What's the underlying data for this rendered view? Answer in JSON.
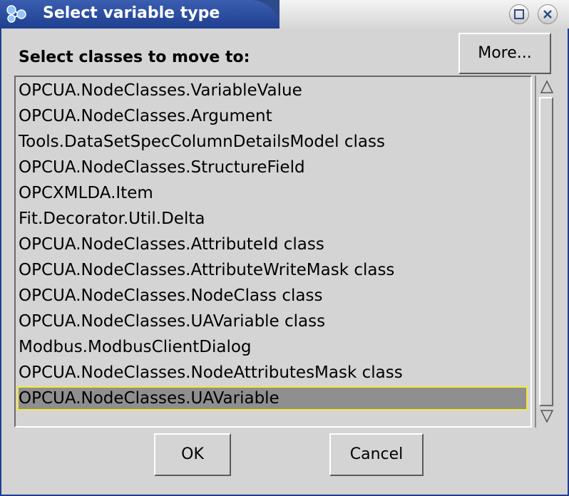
{
  "window": {
    "title": "Select variable type",
    "icons": {
      "app": "app-network-icon",
      "maximize": "maximize-icon",
      "close": "close-icon"
    }
  },
  "dialog": {
    "heading": "Select classes to move to:",
    "more_label": "More...",
    "ok_label": "OK",
    "cancel_label": "Cancel"
  },
  "list": {
    "items": [
      "OPCUA.NodeClasses.VariableValue",
      "OPCUA.NodeClasses.Argument",
      "Tools.DataSetSpecColumnDetailsModel class",
      "OPCUA.NodeClasses.StructureField",
      "OPCXMLDA.Item",
      "Fit.Decorator.Util.Delta",
      "OPCUA.NodeClasses.AttributeId class",
      "OPCUA.NodeClasses.AttributeWriteMask class",
      "OPCUA.NodeClasses.NodeClass class",
      "OPCUA.NodeClasses.UAVariable class",
      "Modbus.ModbusClientDialog",
      "OPCUA.NodeClasses.NodeAttributesMask class",
      "OPCUA.NodeClasses.UAVariable"
    ],
    "selected_index": 12
  },
  "colors": {
    "titlebar": "#1f3f8f",
    "selection": "#8f8f8f",
    "selection_outline": "#f2e83c",
    "dialog_bg": "#d4d4d4"
  }
}
